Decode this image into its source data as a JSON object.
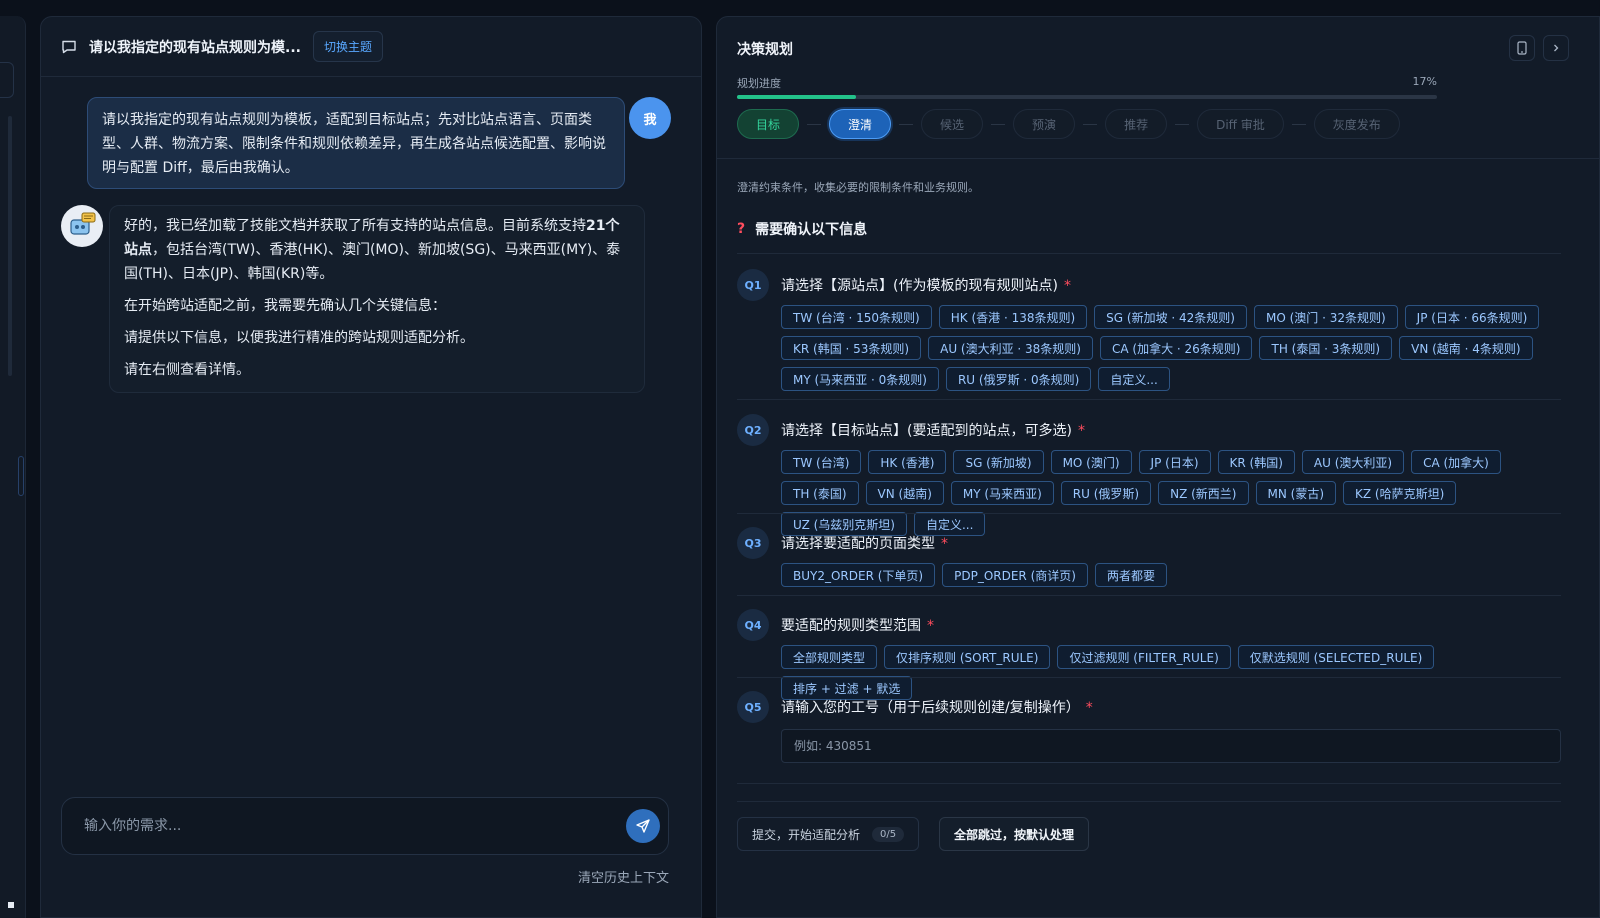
{
  "chat": {
    "title": "请以我指定的现有站点规则为模...",
    "switch_topic": "切换主题",
    "user_avatar": "我",
    "user_message": "请以我指定的现有站点规则为模板，适配到目标站点；先对比站点语言、页面类型、人群、物流方案、限制条件和规则依赖差异，再生成各站点候选配置、影响说明与配置 Diff，最后由我确认。",
    "bot": {
      "p1_a": "好的，我已经加载了技能文档并获取了所有支持的站点信息。目前系统支持",
      "p1_bold": "21个站点",
      "p1_b": "，包括台湾(TW)、香港(HK)、澳门(MO)、新加坡(SG)、马来西亚(MY)、泰国(TH)、日本(JP)、韩国(KR)等。",
      "p2": "在开始跨站适配之前，我需要先确认几个关键信息：",
      "p3": "请提供以下信息，以便我进行精准的跨站规则适配分析。",
      "p4": "请在右侧查看详情。"
    },
    "input_placeholder": "输入你的需求...",
    "clear_history": "清空历史上下文"
  },
  "decision": {
    "title": "决策规划",
    "progress_label": "规划进度",
    "progress_pct": "17%",
    "progress_value": 0.17,
    "steps": [
      "目标",
      "澄清",
      "候选",
      "预演",
      "推荐",
      "Diff 审批",
      "灰度发布"
    ],
    "description": "澄清约束条件，收集必要的限制条件和业务规则。",
    "need_title": "需要确认以下信息",
    "questions": [
      {
        "badge": "Q1",
        "title": "请选择【源站点】(作为模板的现有规则站点)",
        "options": [
          "TW (台湾 · 150条规则)",
          "HK (香港 · 138条规则)",
          "SG (新加坡 · 42条规则)",
          "MO (澳门 · 32条规则)",
          "JP (日本 · 66条规则)",
          "KR (韩国 · 53条规则)",
          "AU (澳大利亚 · 38条规则)",
          "CA (加拿大 · 26条规则)",
          "TH (泰国 · 3条规则)",
          "VN (越南 · 4条规则)",
          "MY (马来西亚 · 0条规则)",
          "RU (俄罗斯 · 0条规则)",
          "自定义..."
        ]
      },
      {
        "badge": "Q2",
        "title": "请选择【目标站点】(要适配到的站点，可多选)",
        "options": [
          "TW (台湾)",
          "HK (香港)",
          "SG (新加坡)",
          "MO (澳门)",
          "JP (日本)",
          "KR (韩国)",
          "AU (澳大利亚)",
          "CA (加拿大)",
          "TH (泰国)",
          "VN (越南)",
          "MY (马来西亚)",
          "RU (俄罗斯)",
          "NZ (新西兰)",
          "MN (蒙古)",
          "KZ (哈萨克斯坦)",
          "UZ (乌兹别克斯坦)",
          "自定义..."
        ]
      },
      {
        "badge": "Q3",
        "title": "请选择要适配的页面类型",
        "options": [
          "BUY2_ORDER (下单页)",
          "PDP_ORDER (商详页)",
          "两者都要"
        ]
      },
      {
        "badge": "Q4",
        "title": "要适配的规则类型范围",
        "options": [
          "全部规则类型",
          "仅排序规则 (SORT_RULE)",
          "仅过滤规则 (FILTER_RULE)",
          "仅默选规则 (SELECTED_RULE)",
          "排序 + 过滤 + 默选"
        ]
      },
      {
        "badge": "Q5",
        "title": "请输入您的工号（用于后续规则创建/复制操作）",
        "placeholder": "例如: 430851"
      }
    ],
    "required_mark": "*",
    "submit_label": "提交，开始适配分析",
    "submit_count": "0/5",
    "skip_label": "全部跳过，按默认处理"
  },
  "colors": {
    "accent": "#4c9cf6",
    "success": "#33d39b",
    "required": "#ff4d5e"
  }
}
